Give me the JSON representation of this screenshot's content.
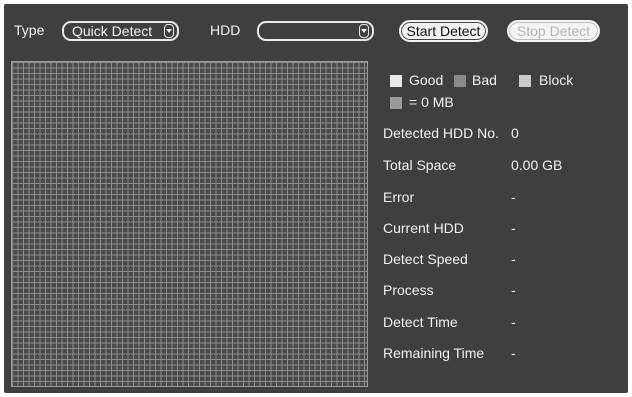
{
  "toolbar": {
    "type_label": "Type",
    "type_value": "Quick Detect",
    "hdd_label": "HDD",
    "hdd_value": "",
    "start_label": "Start Detect",
    "stop_label": "Stop Detect"
  },
  "legend": {
    "good": "Good",
    "bad": "Bad",
    "block": "Block",
    "unit": "= 0 MB",
    "colors": {
      "good": "#e9e9e9",
      "bad": "#8a8a8a",
      "block": "#c9c9c9",
      "unit": "#9a9a9a"
    }
  },
  "info": {
    "detected_hdd_no": {
      "label": "Detected HDD No.",
      "value": "0"
    },
    "total_space": {
      "label": "Total Space",
      "value": "0.00 GB"
    },
    "error": {
      "label": "Error",
      "value": "-"
    },
    "current_hdd": {
      "label": "Current HDD",
      "value": "-"
    },
    "detect_speed": {
      "label": "Detect Speed",
      "value": "-"
    },
    "process": {
      "label": "Process",
      "value": "-"
    },
    "detect_time": {
      "label": "Detect Time",
      "value": "-"
    },
    "remaining_time": {
      "label": "Remaining Time",
      "value": "-"
    }
  }
}
